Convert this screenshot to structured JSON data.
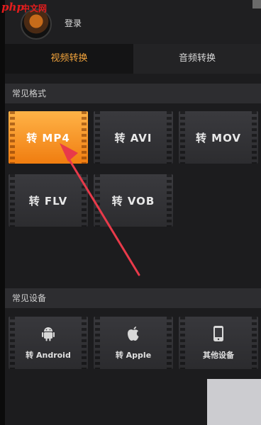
{
  "watermark": {
    "php": "php",
    "site": "中文网"
  },
  "header": {
    "login": "登录"
  },
  "tabs": [
    {
      "label": "视频转换",
      "active": true
    },
    {
      "label": "音频转换",
      "active": false
    }
  ],
  "sections": {
    "formats": {
      "title": "常见格式"
    },
    "devices": {
      "title": "常见设备"
    }
  },
  "formats": [
    {
      "label": "转 MP4",
      "active": true
    },
    {
      "label": "转 AVI",
      "active": false
    },
    {
      "label": "转 MOV",
      "active": false
    },
    {
      "label": "转 FLV",
      "active": false
    },
    {
      "label": "转 VOB",
      "active": false
    }
  ],
  "devices": [
    {
      "label": "转 Android",
      "icon": "android-icon"
    },
    {
      "label": "转 Apple",
      "icon": "apple-icon"
    },
    {
      "label": "其他设备",
      "icon": "phone-icon"
    }
  ],
  "colors": {
    "accent": "#f3a43c",
    "active_card": "#f58a1f",
    "arrow": "#e83a4a"
  }
}
